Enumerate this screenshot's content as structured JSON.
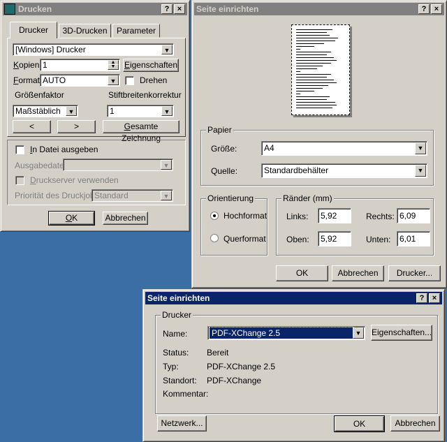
{
  "drucken": {
    "title": "Drucken",
    "tabs": [
      "Drucker",
      "3D-Drucken",
      "Parameter"
    ],
    "printer_value": "[Windows] Drucker",
    "copies_label": "Kopien",
    "copies_value": "1",
    "properties_button": "Eigenschaften",
    "format_label": "Format",
    "format_value": "AUTO",
    "rotate_label": "Drehen",
    "scale_label": "Größenfaktor",
    "stroke_label": "Stiftbreitenkorrektur",
    "scale_value": "Maßstäblich",
    "stroke_value": "1",
    "prev_button": "<",
    "next_button": ">",
    "whole_drawing_button": "Gesamte Zeichnung",
    "to_file_label": "In Datei ausgeben",
    "output_file_label": "Ausgabedatei",
    "output_file_value": "",
    "print_server_label": "Druckserver verwenden",
    "priority_label": "Priorität des Druckjobs",
    "priority_value": "Standard",
    "ok_button": "OK",
    "cancel_button": "Abbrechen"
  },
  "seite": {
    "title": "Seite einrichten",
    "paper_group": "Papier",
    "size_label": "Größe:",
    "size_value": "A4",
    "source_label": "Quelle:",
    "source_value": "Standardbehälter",
    "orientation_group": "Orientierung",
    "portrait_label": "Hochformat",
    "landscape_label": "Querformat",
    "orientation_selected": "Hochformat",
    "margins_group": "Ränder (mm)",
    "left_label": "Links:",
    "left_value": "5,92",
    "right_label": "Rechts:",
    "right_value": "6,09",
    "top_label": "Oben:",
    "top_value": "5,92",
    "bottom_label": "Unten:",
    "bottom_value": "6,01",
    "ok_button": "OK",
    "cancel_button": "Abbrechen",
    "printer_button": "Drucker..."
  },
  "seite2": {
    "title": "Seite einrichten",
    "printer_group": "Drucker",
    "name_label": "Name:",
    "name_value": "PDF-XChange 2.5",
    "properties_button": "Eigenschaften...",
    "status_label": "Status:",
    "status_value": "Bereit",
    "type_label": "Typ:",
    "type_value": "PDF-XChange 2.5",
    "location_label": "Standort:",
    "location_value": "PDF-XChange",
    "comment_label": "Kommentar:",
    "comment_value": "",
    "network_button": "Netzwerk...",
    "ok_button": "OK",
    "cancel_button": "Abbrechen"
  },
  "titlebar_buttons": {
    "help": "?",
    "close": "×"
  },
  "colors": {
    "desktop": "#3a6ea5",
    "dialog": "#d4d0c8",
    "active_title": "#0a246a",
    "inactive_title": "#808080"
  }
}
